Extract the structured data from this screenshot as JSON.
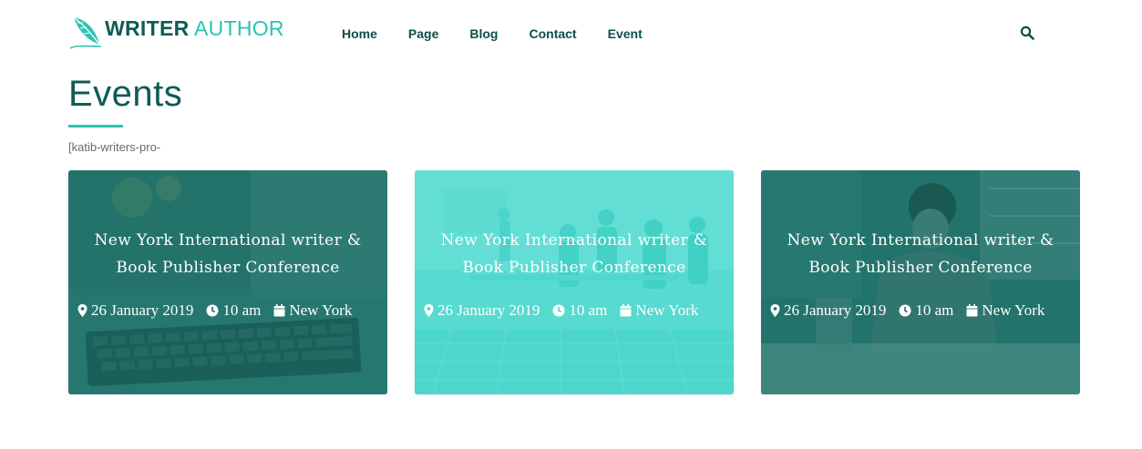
{
  "header": {
    "logo": {
      "word1": "WRITER",
      "word2": "AUTHOR",
      "icon": "feather-pen-icon"
    },
    "nav": [
      {
        "label": "Home"
      },
      {
        "label": "Page"
      },
      {
        "label": "Blog"
      },
      {
        "label": "Contact"
      },
      {
        "label": "Event"
      }
    ],
    "search_icon": "search-icon"
  },
  "page": {
    "title": "Events",
    "shortcode": "[katib-writers-pro-"
  },
  "events": [
    {
      "title_line1": "New York International writer &",
      "title_line2": "Book Publisher Conference",
      "date": "26 January 2019",
      "time": "10 am",
      "location": "New York",
      "image": "keyboard-desk-photo",
      "overlay_color": "#1a6d66"
    },
    {
      "title_line1": "New York International writer &",
      "title_line2": "Book Publisher Conference",
      "date": "26 January 2019",
      "time": "10 am",
      "location": "New York",
      "image": "classroom-photo",
      "overlay_color": "#2fd3c6"
    },
    {
      "title_line1": "New York International writer &",
      "title_line2": "Book Publisher Conference",
      "date": "26 January 2019",
      "time": "10 am",
      "location": "New York",
      "image": "man-writing-photo",
      "overlay_color": "#1a6d66"
    }
  ],
  "colors": {
    "brand_dark": "#0d5b55",
    "brand_accent": "#2cc3b4",
    "nav_text": "#0d4f4a"
  }
}
